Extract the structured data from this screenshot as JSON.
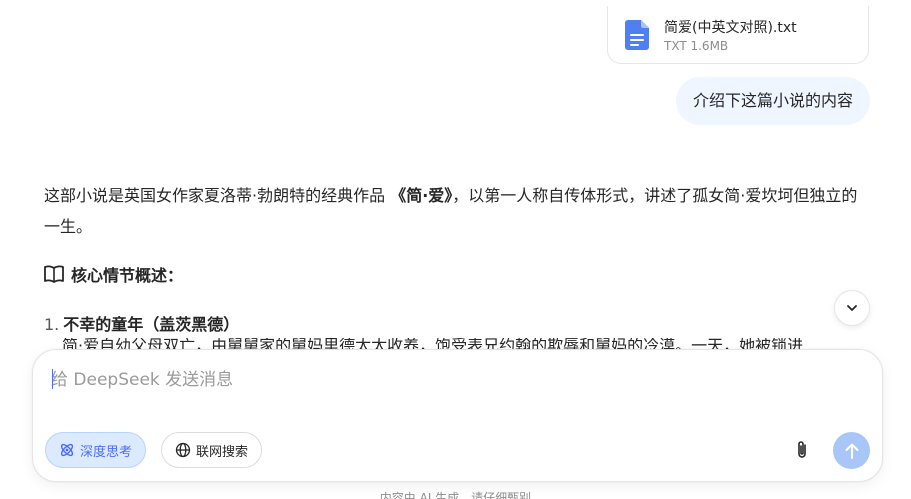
{
  "attachment": {
    "file_name": "简爱(中英文对照).txt",
    "file_meta": "TXT 1.6MB",
    "icon": "document-icon"
  },
  "user_message": "介绍下这篇小说的内容",
  "answer": {
    "intro_before": "这部小说是英国女作家夏洛蒂·勃朗特的经典作品",
    "intro_title": "《简·爱》",
    "intro_after": "，以第一人称自传体形式，讲述了孤女简·爱坎坷但独立的一生。",
    "section_heading": "核心情节概述：",
    "section_icon": "open-book-icon",
    "list": [
      {
        "number": "1.",
        "title": "不幸的童年（盖茨黑德）",
        "text_partial": "简·爱自幼父母双亡，由舅舅家的舅妈里德太太收养，饱受表兄约翰的欺辱和舅妈的冷漠。一天，她被锁进"
      }
    ]
  },
  "scroll_button": {
    "icon": "chevron-down-icon"
  },
  "composer": {
    "placeholder": "给 DeepSeek 发送消息",
    "value": "",
    "deep_think_label": "深度思考",
    "deep_think_icon": "atom-icon",
    "deep_think_active": true,
    "web_search_label": "联网搜索",
    "web_search_icon": "globe-icon",
    "attach_icon": "paperclip-icon",
    "send_icon": "arrow-up-icon"
  },
  "disclaimer": "内容由 AI 生成，请仔细甄别",
  "colors": {
    "accent": "#4d6bfe",
    "user_bubble": "#eff6ff",
    "send_disabled": "#a9c6f9",
    "file_icon": "#4f7ff0"
  }
}
